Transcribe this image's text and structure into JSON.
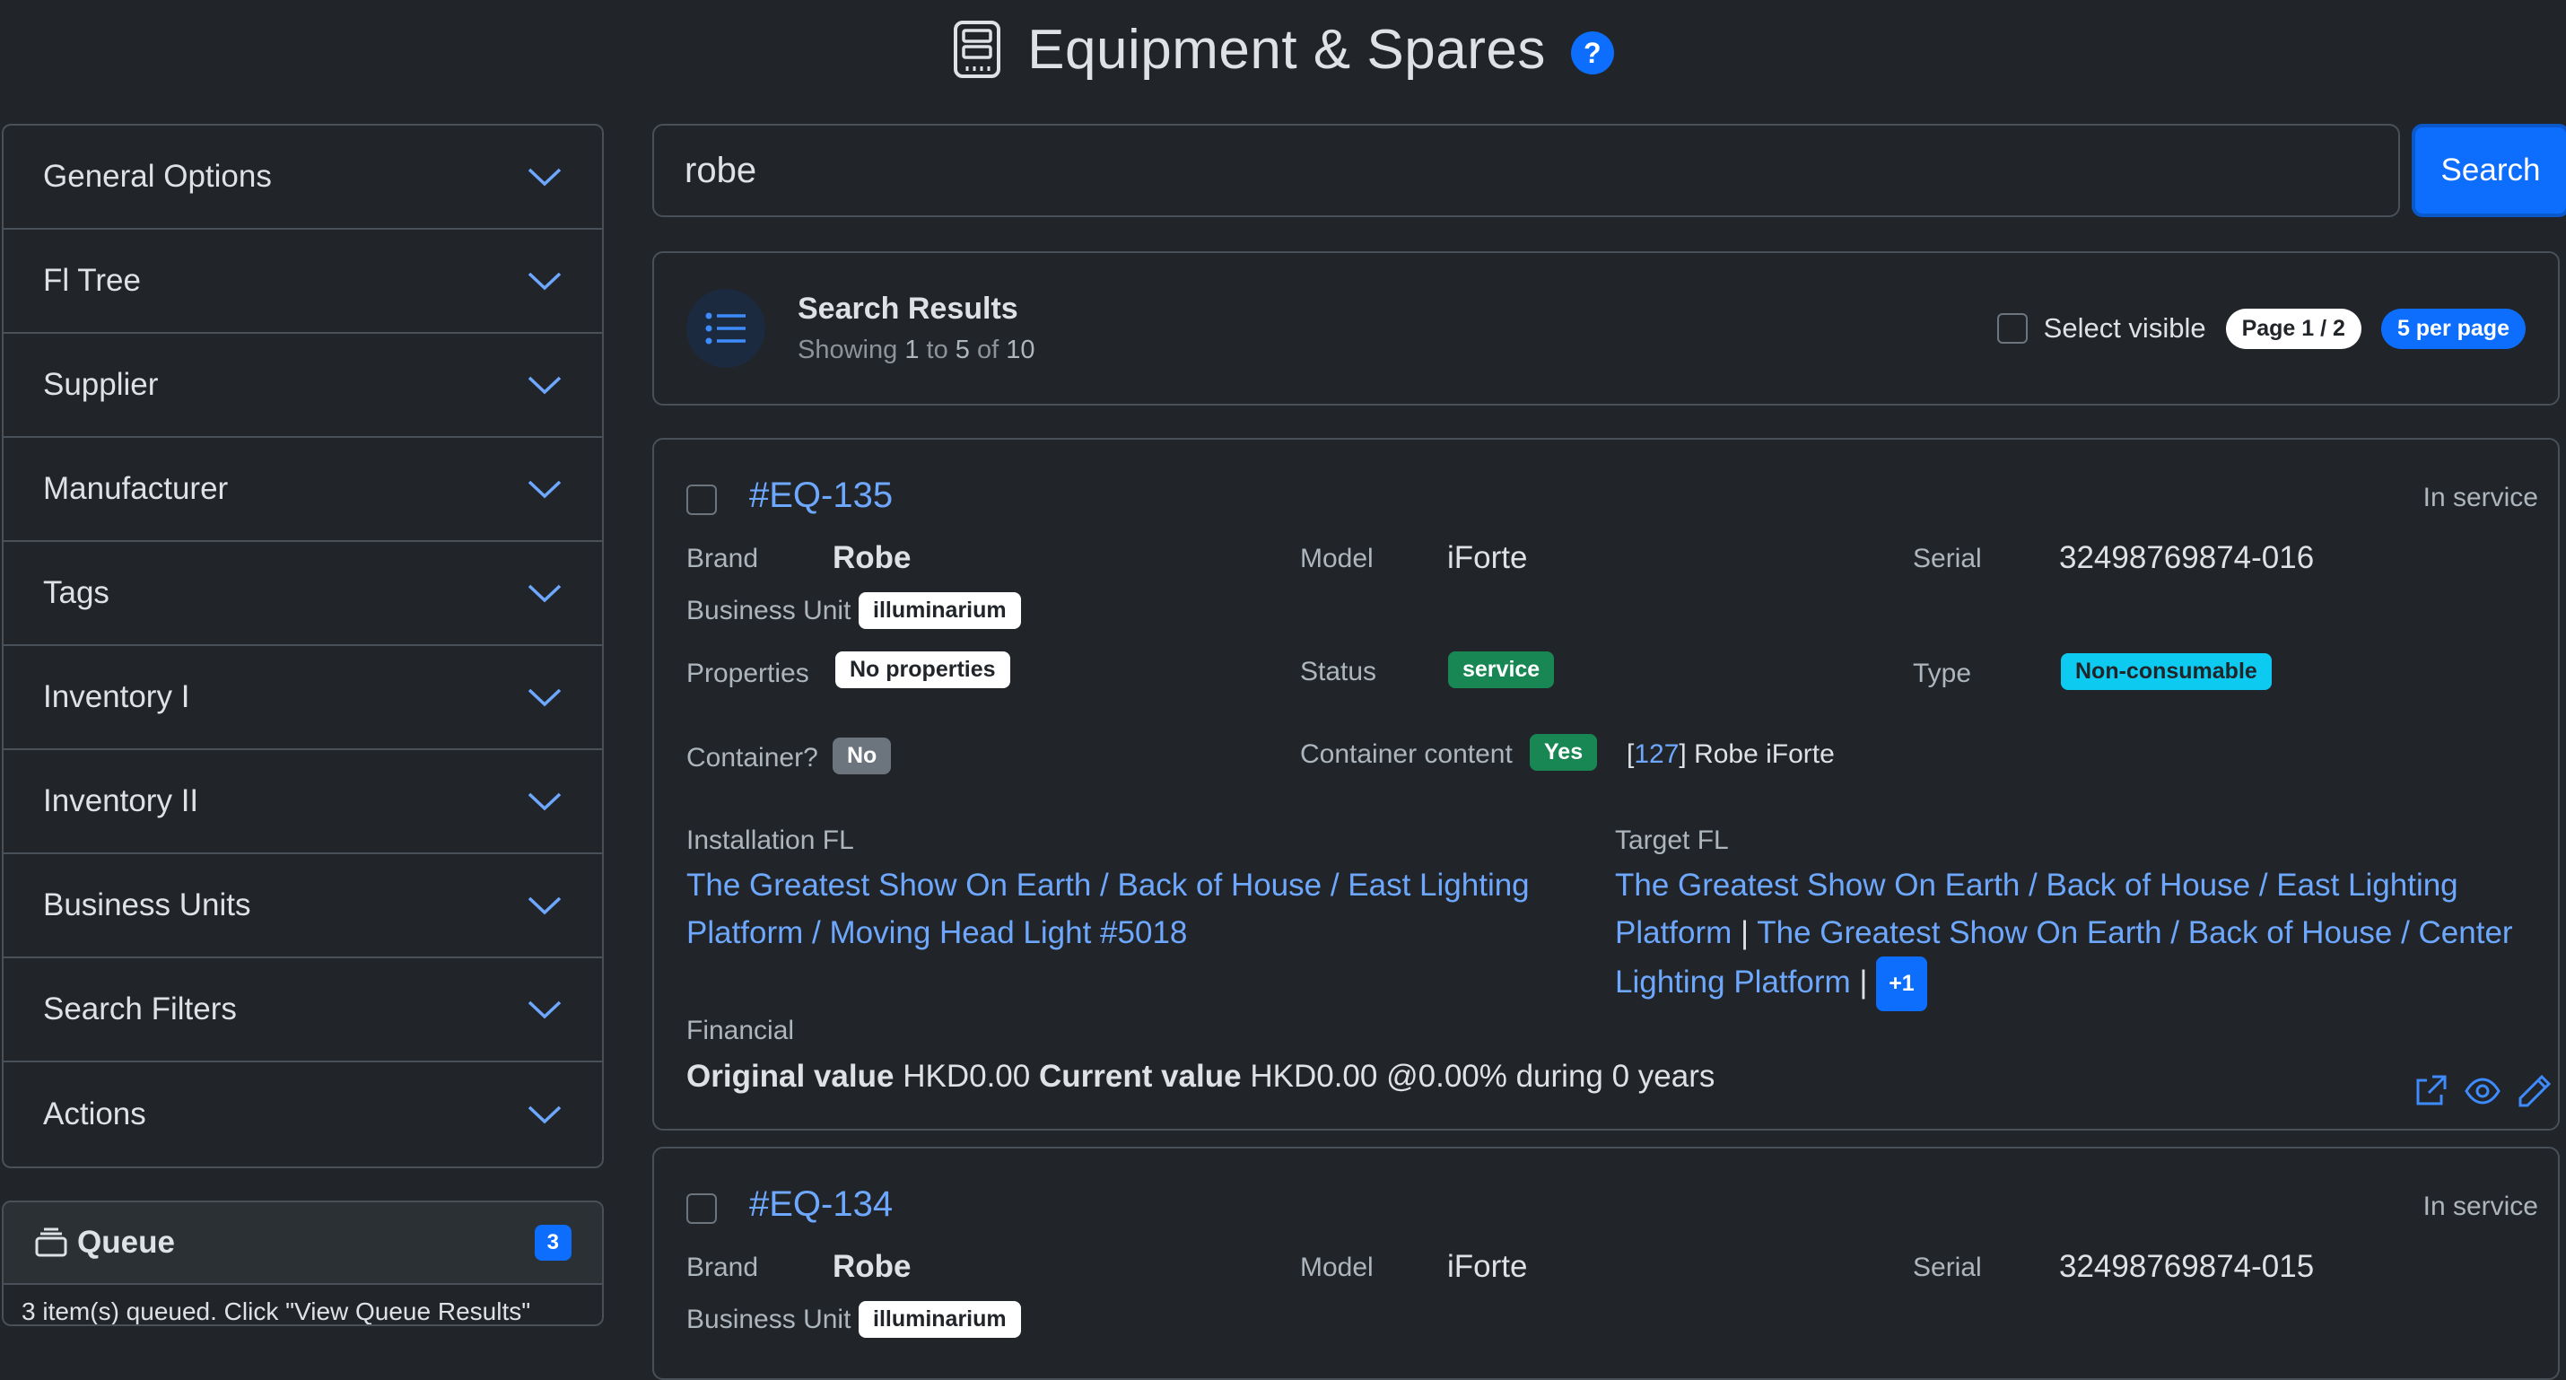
{
  "header": {
    "title": "Equipment & Spares",
    "help_label": "?"
  },
  "sidebar": {
    "items": [
      {
        "label": "General Options"
      },
      {
        "label": "Fl Tree"
      },
      {
        "label": "Supplier"
      },
      {
        "label": "Manufacturer"
      },
      {
        "label": "Tags"
      },
      {
        "label": "Inventory I"
      },
      {
        "label": "Inventory II"
      },
      {
        "label": "Business Units"
      },
      {
        "label": "Search Filters"
      },
      {
        "label": "Actions"
      }
    ]
  },
  "queue": {
    "title": "Queue",
    "count": "3",
    "hint": "3 item(s) queued. Click \"View Queue Results\""
  },
  "search": {
    "value": "robe",
    "button_label": "Search"
  },
  "results": {
    "title": "Search Results",
    "showing_prefix": "Showing",
    "from": "1",
    "to_word": "to",
    "to": "5",
    "of_word": "of",
    "total": "10",
    "select_visible_label": "Select visible",
    "page_label": "Page 1 / 2",
    "per_page_label": "5 per page"
  },
  "cards": [
    {
      "id": "#EQ-135",
      "state": "In service",
      "brand_label": "Brand",
      "brand": "Robe",
      "model_label": "Model",
      "model": "iForte",
      "serial_label": "Serial",
      "serial": "32498769874-016",
      "bu_label": "Business Unit",
      "bu": "illuminarium",
      "properties_label": "Properties",
      "properties": "No properties",
      "status_label": "Status",
      "status": "service",
      "type_label": "Type",
      "type": "Non-consumable",
      "container_label": "Container?",
      "container": "No",
      "content_label": "Container content",
      "content": "Yes",
      "content_ref": "127",
      "content_name": "Robe iForte",
      "install_label": "Installation FL",
      "install_fl": "The Greatest Show On Earth / Back of House / East Lighting Platform / Moving Head Light #5018",
      "target_label": "Target FL",
      "target_fl_1": "The Greatest Show On Earth / Back of House / East Lighting Platform",
      "target_fl_2": "The Greatest Show On Earth / Back of House / Center Lighting Platform",
      "target_more": "+1",
      "financial_label": "Financial",
      "orig_label": "Original value",
      "orig_value": "HKD0.00",
      "curr_label": "Current value",
      "curr_value": "HKD0.00",
      "depr_text": "@0.00% during 0 years"
    },
    {
      "id": "#EQ-134",
      "state": "In service",
      "brand_label": "Brand",
      "brand": "Robe",
      "model_label": "Model",
      "model": "iForte",
      "serial_label": "Serial",
      "serial": "32498769874-015",
      "bu_label": "Business Unit",
      "bu": "illuminarium"
    }
  ],
  "colors": {
    "background": "#212529",
    "accent": "#0d6efd",
    "link": "#6ea8fe",
    "success": "#198754",
    "info": "#0dcaf0"
  }
}
